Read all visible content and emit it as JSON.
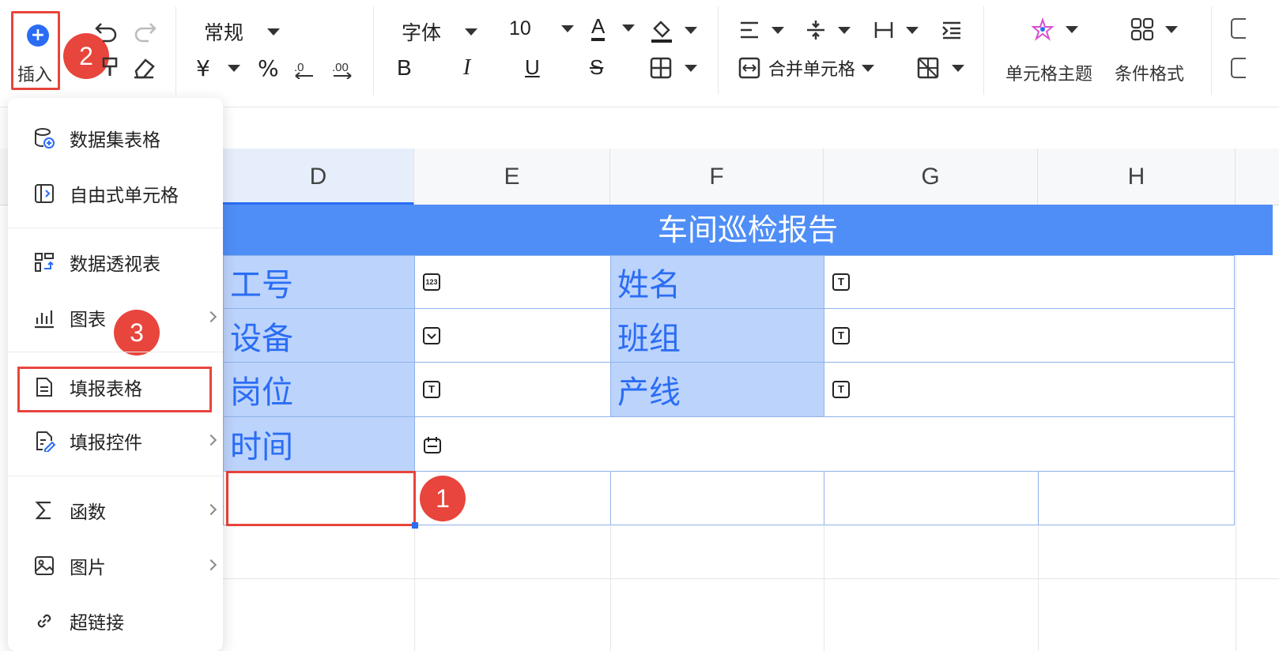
{
  "toolbar": {
    "insert_label": "插入",
    "number_format": "常规",
    "font_name": "字体",
    "font_size": "10",
    "merge_label": "合并单元格",
    "cell_theme_label": "单元格主题",
    "conditional_format_label": "条件格式",
    "currency_symbol": "¥",
    "percent_symbol": "%",
    "bold": "B",
    "italic": "I",
    "underline": "U",
    "strike": "S",
    "font_color_glyph": "A"
  },
  "steps": {
    "one": "1",
    "two": "2",
    "three": "3"
  },
  "columns": [
    "D",
    "E",
    "F",
    "G",
    "H"
  ],
  "active_column": "D",
  "sheet": {
    "title": "车间巡检报告",
    "rows": [
      {
        "label1": "工号",
        "ctl1": "123",
        "label2": "姓名",
        "ctl2": "T"
      },
      {
        "label1": "设备",
        "ctl1": "v",
        "label2": "班组",
        "ctl2": "T"
      },
      {
        "label1": "岗位",
        "ctl1": "T",
        "label2": "产线",
        "ctl2": "T"
      },
      {
        "label1": "时间",
        "ctl1": "date"
      }
    ]
  },
  "menu": {
    "items": [
      {
        "label": "数据集表格",
        "icon": "dataset-table-icon",
        "submenu": false
      },
      {
        "label": "自由式单元格",
        "icon": "free-cell-icon",
        "submenu": false
      },
      {
        "label": "数据透视表",
        "icon": "pivot-table-icon",
        "submenu": false
      },
      {
        "label": "图表",
        "icon": "bar-chart-icon",
        "submenu": true
      },
      {
        "label": "填报表格",
        "icon": "form-document-icon",
        "submenu": false
      },
      {
        "label": "填报控件",
        "icon": "form-control-icon",
        "submenu": true
      },
      {
        "label": "函数",
        "icon": "sigma-icon",
        "submenu": true
      },
      {
        "label": "图片",
        "icon": "image-icon",
        "submenu": true
      },
      {
        "label": "超链接",
        "icon": "link-icon",
        "submenu": false
      }
    ]
  },
  "colors": {
    "accent_blue": "#2a6df4",
    "header_blue": "#4f8ef7",
    "label_fill": "#bcd3fb",
    "highlight_red": "#e8453c"
  }
}
